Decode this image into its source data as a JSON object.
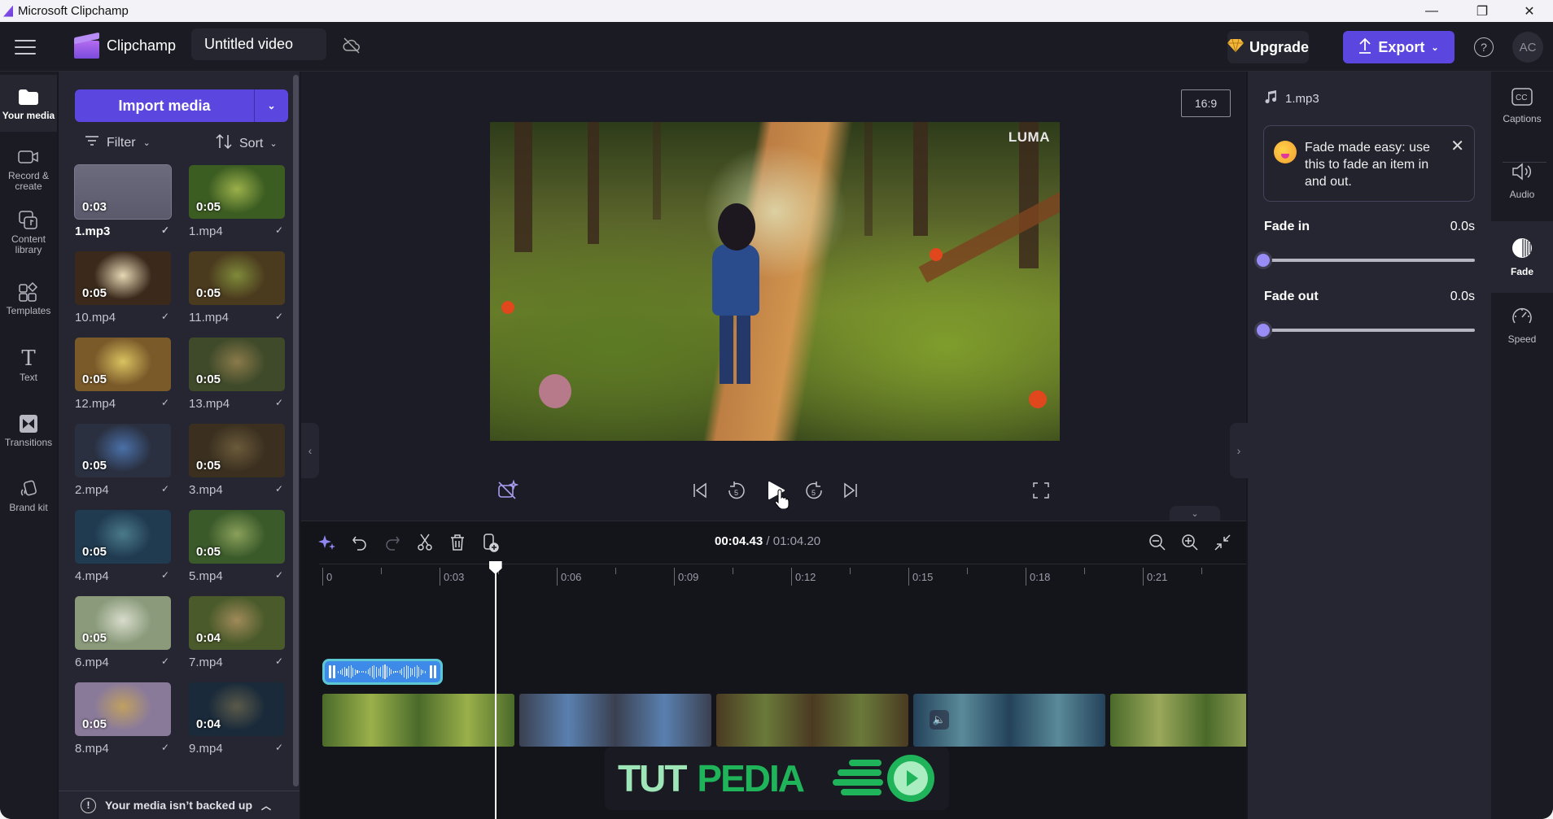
{
  "window": {
    "title": "Microsoft Clipchamp",
    "controls": {
      "minimize": "—",
      "maximize": "❐",
      "close": "✕"
    }
  },
  "header": {
    "brand": "Clipchamp",
    "project_title": "Untitled video",
    "upgrade_label": "Upgrade",
    "export_label": "Export",
    "help_glyph": "?",
    "avatar_initials": "AC"
  },
  "left_rail": {
    "items": [
      {
        "label": "Your media",
        "icon": "folder-icon",
        "active": true
      },
      {
        "label": "Record & create",
        "icon": "camera-icon"
      },
      {
        "label": "Content library",
        "icon": "content-library-icon"
      },
      {
        "label": "Templates",
        "icon": "templates-icon"
      },
      {
        "label": "Text",
        "icon": "text-icon"
      },
      {
        "label": "Transitions",
        "icon": "transitions-icon"
      },
      {
        "label": "Brand kit",
        "icon": "brand-kit-icon"
      }
    ]
  },
  "media_panel": {
    "import_label": "Import media",
    "filter_label": "Filter",
    "sort_label": "Sort",
    "items": [
      {
        "name": "1.mp3",
        "duration": "0:03",
        "type": "audio",
        "selected": true,
        "colors": [
          "#5a5a6c",
          "#6b6b7d"
        ]
      },
      {
        "name": "1.mp4",
        "duration": "0:05",
        "colors": [
          "#3c5d22",
          "#9bb04a"
        ]
      },
      {
        "name": "10.mp4",
        "duration": "0:05",
        "colors": [
          "#3b2a1c",
          "#e6d7b4"
        ]
      },
      {
        "name": "11.mp4",
        "duration": "0:05",
        "colors": [
          "#4a3a1e",
          "#7f8a3a"
        ]
      },
      {
        "name": "12.mp4",
        "duration": "0:05",
        "colors": [
          "#7b5a2a",
          "#d9c260"
        ]
      },
      {
        "name": "13.mp4",
        "duration": "0:05",
        "colors": [
          "#3f4a2a",
          "#8a7a4a"
        ]
      },
      {
        "name": "2.mp4",
        "duration": "0:05",
        "colors": [
          "#2a3040",
          "#4a70a8"
        ]
      },
      {
        "name": "3.mp4",
        "duration": "0:05",
        "colors": [
          "#3b3020",
          "#6b5a3a"
        ]
      },
      {
        "name": "4.mp4",
        "duration": "0:05",
        "colors": [
          "#203a50",
          "#4a7a8a"
        ]
      },
      {
        "name": "5.mp4",
        "duration": "0:05",
        "colors": [
          "#3a5a2a",
          "#8aa05a"
        ]
      },
      {
        "name": "6.mp4",
        "duration": "0:05",
        "colors": [
          "#8a9a7a",
          "#d8dccc"
        ]
      },
      {
        "name": "7.mp4",
        "duration": "0:04",
        "colors": [
          "#4a5a2a",
          "#a08a5a"
        ]
      },
      {
        "name": "8.mp4",
        "duration": "0:05",
        "colors": [
          "#8a7a9a",
          "#c0a060"
        ]
      },
      {
        "name": "9.mp4",
        "duration": "0:04",
        "colors": [
          "#1a2a3a",
          "#5a5a4a"
        ]
      }
    ],
    "backup_notice": "Your media isn’t backed up"
  },
  "preview": {
    "aspect_ratio": "16:9",
    "watermark_text": "LUMA"
  },
  "playback": {
    "controls": [
      {
        "name": "skip-to-start",
        "glyph": "⏮"
      },
      {
        "name": "rewind-5",
        "glyph": "↺",
        "sub": "5"
      },
      {
        "name": "play",
        "glyph": "▶"
      },
      {
        "name": "forward-5",
        "glyph": "↻",
        "sub": "5"
      },
      {
        "name": "skip-to-end",
        "glyph": "⏭"
      }
    ]
  },
  "timeline": {
    "current_time": "00:04.43",
    "separator": " / ",
    "total_time": "01:04.20",
    "ruler_labels": [
      "0",
      "0:03",
      "0:06",
      "0:09",
      "0:12",
      "0:15",
      "0:18",
      "0:21"
    ],
    "playhead_seconds": 4.43,
    "audio_clip": {
      "name": "1.mp3",
      "duration_seconds": 3
    },
    "video_clips": [
      {
        "name": "1.mp4",
        "colors": [
          "#4a6a2a",
          "#9ab04a"
        ]
      },
      {
        "name": "2.mp4",
        "colors": [
          "#3a4050",
          "#5a80b0"
        ]
      },
      {
        "name": "3.mp4",
        "colors": [
          "#4a3a22",
          "#6a7a3a"
        ]
      },
      {
        "name": "4.mp4",
        "colors": [
          "#24425a",
          "#5a8a9a"
        ],
        "audio_icon": true
      },
      {
        "name": "5.mp4",
        "colors": [
          "#4a6a2a",
          "#9aa85a"
        ]
      }
    ]
  },
  "overlay_watermark": {
    "part1": "TUT",
    "part2": "PEDIA"
  },
  "right_panel": {
    "file_name": "1.mp3",
    "tip_text": "Fade made easy: use this to fade an item in and out.",
    "fade_in": {
      "label": "Fade in",
      "value": "0.0s",
      "fraction": 0
    },
    "fade_out": {
      "label": "Fade out",
      "value": "0.0s",
      "fraction": 0
    }
  },
  "right_rail": {
    "items": [
      {
        "label": "Captions",
        "icon": "captions-icon"
      },
      {
        "label": "Audio",
        "icon": "audio-icon"
      },
      {
        "label": "Fade",
        "icon": "fade-icon",
        "active": true
      },
      {
        "label": "Speed",
        "icon": "speed-icon"
      }
    ]
  }
}
